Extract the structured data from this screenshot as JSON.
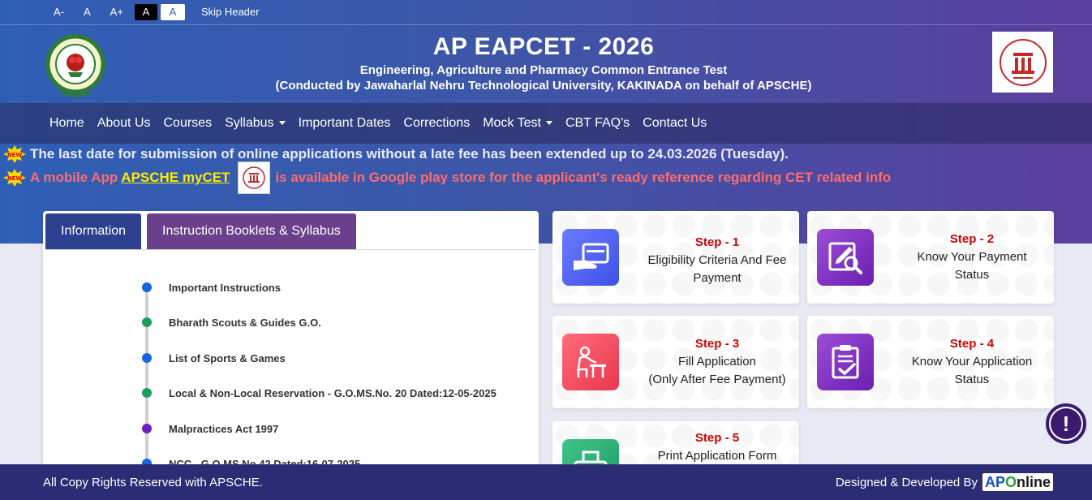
{
  "accessibility": {
    "font_decrease": "A-",
    "font_normal": "A",
    "font_increase": "A+",
    "contrast_dark": "A",
    "contrast_light": "A",
    "skip_header": "Skip Header"
  },
  "header": {
    "title": "AP EAPCET - 2026",
    "subtitle": "Engineering, Agriculture and Pharmacy Common Entrance Test",
    "conducted_by": "(Conducted by Jawaharlal Nehru Technological University, KAKINADA on behalf of APSCHE)"
  },
  "nav": {
    "items": [
      {
        "label": "Home"
      },
      {
        "label": "About Us"
      },
      {
        "label": "Courses"
      },
      {
        "label": "Syllabus"
      },
      {
        "label": "Important Dates"
      },
      {
        "label": "Corrections"
      },
      {
        "label": "Mock Test"
      },
      {
        "label": "CBT FAQ's"
      },
      {
        "label": "Contact Us"
      }
    ]
  },
  "notices": {
    "notice1": "The last date for submission of online applications without a late fee has been extended up to 24.03.2026 (Tuesday).",
    "notice2_prefix": "A mobile App",
    "notice2_link": "APSCHE myCET",
    "notice2_suffix": "is available in Google play store for the applicant's ready reference regarding CET related info",
    "new_badge": "NEW"
  },
  "info_panel": {
    "tabs": [
      {
        "label": "Information"
      },
      {
        "label": "Instruction Booklets & Syllabus"
      }
    ],
    "items": [
      {
        "label": "Important Instructions",
        "color": "#1565e0"
      },
      {
        "label": "Bharath Scouts & Guides G.O.",
        "color": "#1aa05a"
      },
      {
        "label": "List of Sports & Games",
        "color": "#1565e0"
      },
      {
        "label": "Local & Non-Local Reservation - G.O.MS.No. 20 Dated:12-05-2025",
        "color": "#1aa05a"
      },
      {
        "label": "Malpractices Act 1997",
        "color": "#6a1fc0"
      },
      {
        "label": "NCC - G.O.MS.No.42 Dated:16-07-2025",
        "color": "#1565e0"
      }
    ]
  },
  "steps": [
    {
      "label": "Step - 1",
      "line1": "Eligibility Criteria And Fee",
      "line2": "Payment",
      "icon": "card-payment-icon"
    },
    {
      "label": "Step - 2",
      "line1": "Know Your Payment",
      "line2": "Status",
      "icon": "search-edit-icon"
    },
    {
      "label": "Step - 3",
      "line1": "Fill Application",
      "line2": "(Only After Fee Payment)",
      "icon": "person-writing-icon"
    },
    {
      "label": "Step - 4",
      "line1": "Know Your Application",
      "line2": "Status",
      "icon": "clipboard-check-icon"
    },
    {
      "label": "Step - 5",
      "line1": "Print Application Form",
      "line2": "",
      "icon": "printer-icon"
    }
  ],
  "footer": {
    "copyright": "All Copy Rights Reserved with APSCHE.",
    "designed_by": "Designed & Developed By",
    "brand_ap": "AP",
    "brand_o": "O",
    "brand_nline": "nline"
  },
  "colors": {
    "step_label": "#d00000",
    "footer_bg": "#2c2c74",
    "tab_active": "#2d3f8f",
    "tab_inactive": "#6a3f8c"
  }
}
